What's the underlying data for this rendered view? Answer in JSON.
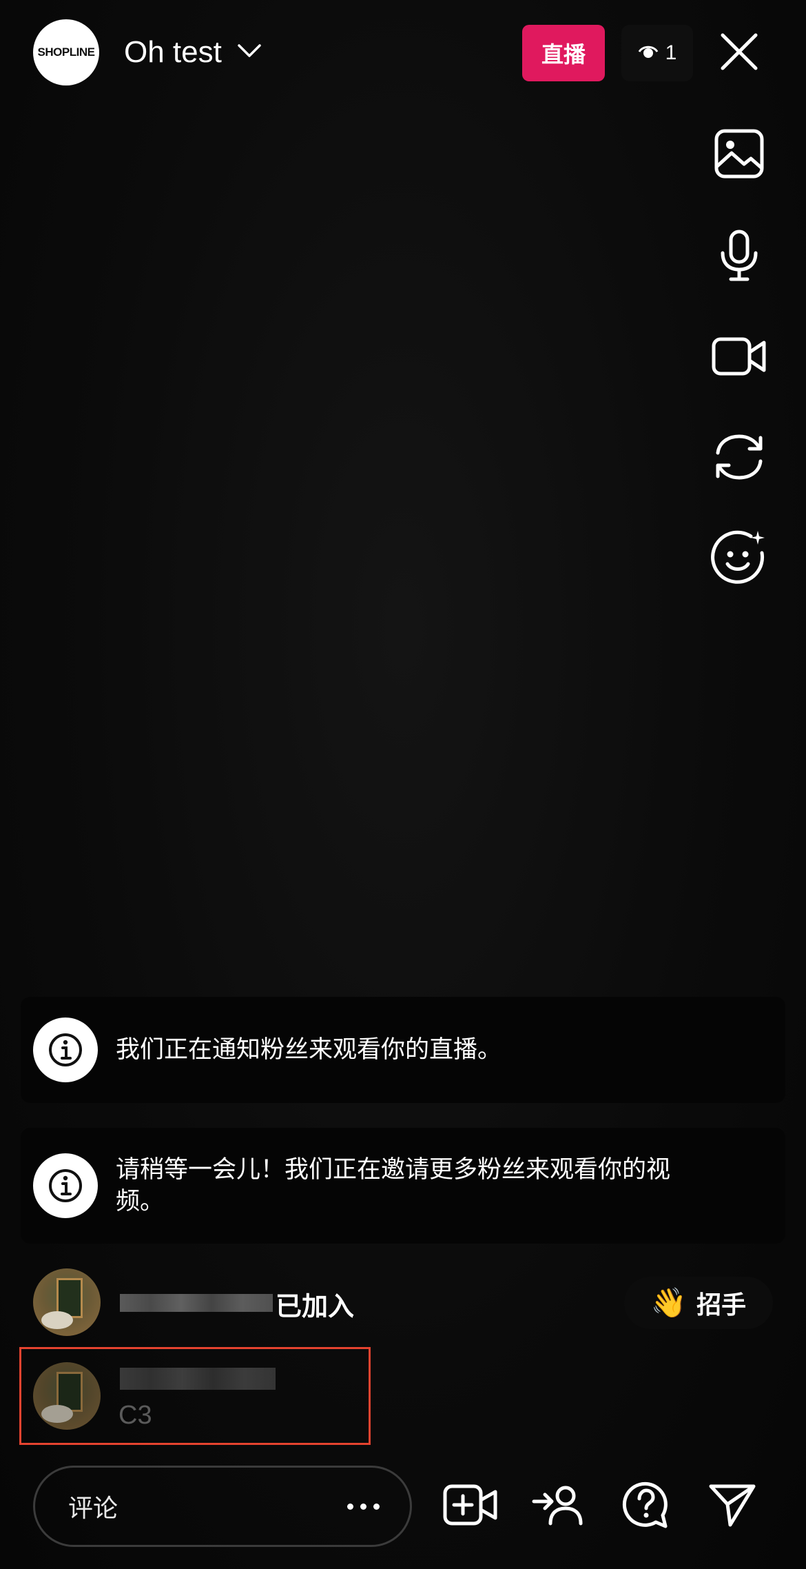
{
  "header": {
    "logo_text": "SHOPLINE",
    "account_name": "Oh test",
    "live_label": "直播",
    "viewer_count": "1"
  },
  "side_toolbar": [
    {
      "icon": "image-icon"
    },
    {
      "icon": "microphone-icon"
    },
    {
      "icon": "video-camera-icon"
    },
    {
      "icon": "flip-camera-icon"
    },
    {
      "icon": "effects-face-icon"
    }
  ],
  "notices": [
    {
      "text": "我们正在通知粉丝来观看你的直播。"
    },
    {
      "text": "请稍等一会儿！我们正在邀请更多粉丝来观看你的视频。"
    }
  ],
  "joined": {
    "text": "已加入",
    "wave_label": "招手",
    "wave_emoji": "👋"
  },
  "comment_preview": {
    "text": "C3"
  },
  "bottom_bar": {
    "comment_placeholder": "评论"
  },
  "colors": {
    "live_badge": "#e0195e",
    "highlight_border": "#e5432f",
    "background": "#0b0b0b"
  }
}
